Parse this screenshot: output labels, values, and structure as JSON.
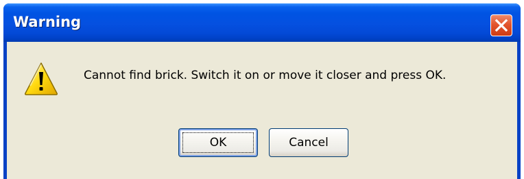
{
  "dialog": {
    "title": "Warning",
    "message": "Cannot find brick. Switch it on or move it closer and press OK.",
    "icon": "warning-icon",
    "close_icon": "close-icon"
  },
  "buttons": {
    "ok_label": "OK",
    "cancel_label": "Cancel"
  },
  "colors": {
    "titlebar": "#0054e3",
    "client_background": "#ece9d8",
    "close_button": "#e3552d",
    "warning_icon": "#ffd700"
  }
}
